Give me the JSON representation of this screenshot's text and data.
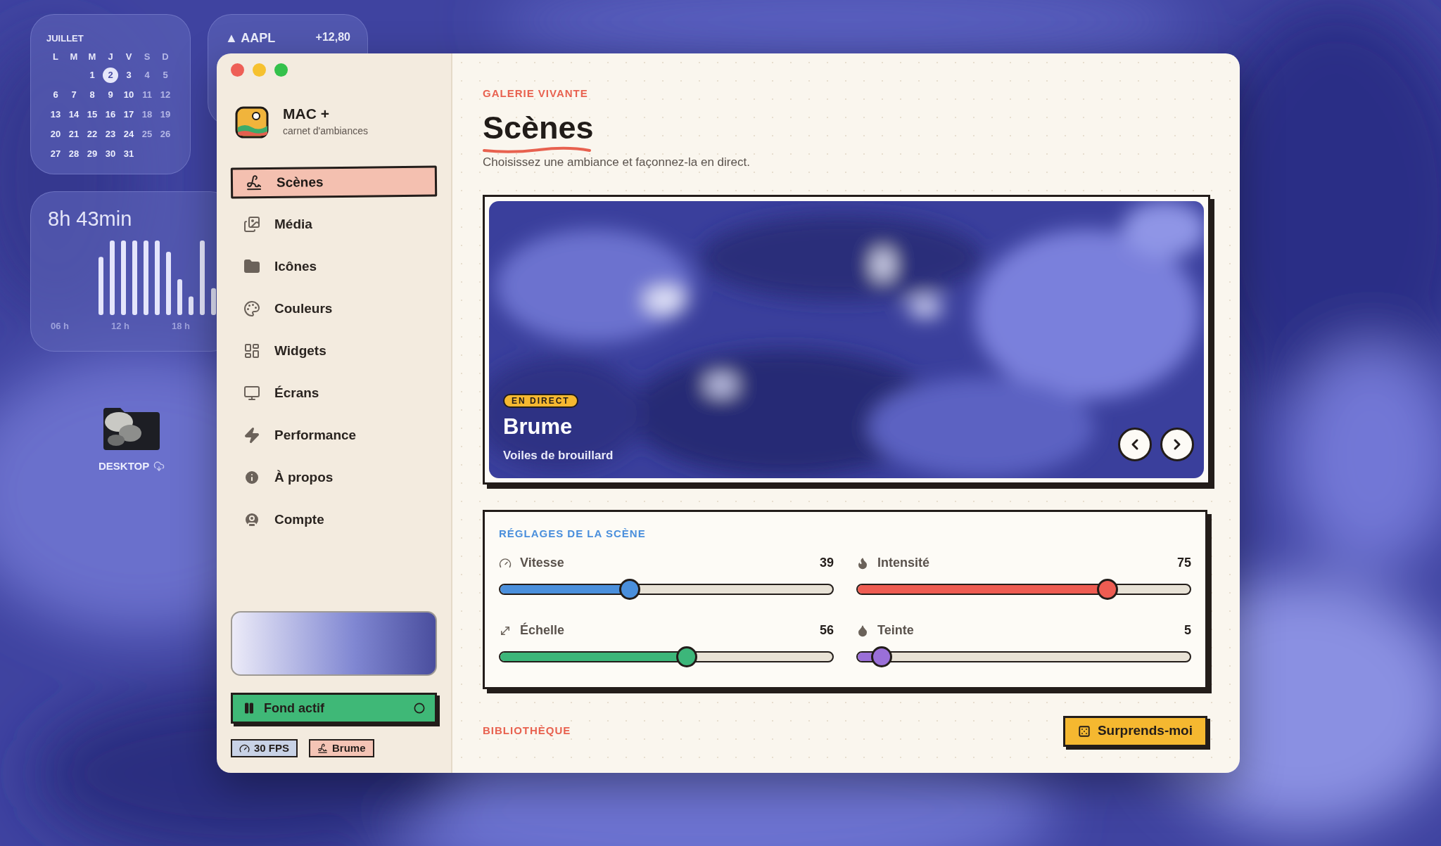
{
  "desktop": {
    "calendar": {
      "month": "JUILLET",
      "weekdays": [
        "L",
        "M",
        "M",
        "J",
        "V",
        "S",
        "D"
      ],
      "weeks": [
        [
          {
            "day": "1",
            "selected": false
          },
          {
            "day": "2",
            "selected": true
          },
          {
            "day": "3",
            "selected": false
          },
          {
            "day": "4",
            "selected": false
          },
          {
            "day": "5",
            "selected": false
          }
        ],
        [
          {
            "day": "6",
            "selected": false
          },
          {
            "day": "7",
            "selected": false
          },
          {
            "day": "8",
            "selected": false
          },
          {
            "day": "9",
            "selected": false
          },
          {
            "day": "10",
            "selected": false
          },
          {
            "day": "11",
            "selected": false
          },
          {
            "day": "12",
            "selected": false
          }
        ],
        [
          {
            "day": "13",
            "selected": false
          },
          {
            "day": "14",
            "selected": false
          },
          {
            "day": "15",
            "selected": false
          },
          {
            "day": "16",
            "selected": false
          },
          {
            "day": "17",
            "selected": false
          },
          {
            "day": "18",
            "selected": false
          },
          {
            "day": "19",
            "selected": false
          }
        ],
        [
          {
            "day": "20",
            "selected": false
          },
          {
            "day": "21",
            "selected": false
          },
          {
            "day": "22",
            "selected": false
          },
          {
            "day": "23",
            "selected": false
          },
          {
            "day": "24",
            "selected": false
          },
          {
            "day": "25",
            "selected": false
          },
          {
            "day": "26",
            "selected": false
          }
        ],
        [
          {
            "day": "27",
            "selected": false
          },
          {
            "day": "28",
            "selected": false
          },
          {
            "day": "29",
            "selected": false
          },
          {
            "day": "30",
            "selected": false
          },
          {
            "day": "31",
            "selected": false
          }
        ]
      ]
    },
    "stock": {
      "symbol": "▲ AAPL",
      "change": "+12,80"
    },
    "screen_time": {
      "total": "8h 43min",
      "axis_labels": [
        "06 h",
        "12 h",
        "18 h"
      ]
    },
    "folder": {
      "label": "DESKTOP"
    }
  },
  "app": {
    "brand": {
      "name": "MAC +",
      "tagline": "carnet d'ambiances"
    },
    "nav": [
      {
        "label": "Scènes",
        "selected": true
      },
      {
        "label": "Média",
        "selected": false
      },
      {
        "label": "Icônes",
        "selected": false
      },
      {
        "label": "Couleurs",
        "selected": false
      },
      {
        "label": "Widgets",
        "selected": false
      },
      {
        "label": "Écrans",
        "selected": false
      },
      {
        "label": "Performance",
        "selected": false
      },
      {
        "label": "À propos",
        "selected": false
      },
      {
        "label": "Compte",
        "selected": false
      }
    ],
    "background_toggle": {
      "label": "Fond actif",
      "on": true
    },
    "chips": [
      "30 FPS",
      "Brume"
    ],
    "header": {
      "eyebrow": "GALERIE VIVANTE",
      "title": "Scènes",
      "subtitle": "Choisissez une ambiance et façonnez-la en direct."
    },
    "hero": {
      "badge": "EN DIRECT",
      "title": "Brume",
      "subtitle": "Voiles de brouillard"
    },
    "settings": {
      "title": "RÉGLAGES DE LA SCÈNE",
      "sliders": [
        {
          "name": "Vitesse",
          "reading": "39",
          "level": 0.39,
          "color": "#4a8fdc"
        },
        {
          "name": "Intensité",
          "reading": "75",
          "level": 0.75,
          "color": "#ee5c52"
        },
        {
          "name": "Échelle",
          "reading": "56",
          "level": 0.56,
          "color": "#3cb67a"
        },
        {
          "name": "Teinte",
          "reading": "5",
          "level": 0.05,
          "color": "#9a6fd8"
        }
      ]
    },
    "library": {
      "title": "BIBLIOTHÈQUE"
    },
    "random_button": "Surprends-moi"
  }
}
